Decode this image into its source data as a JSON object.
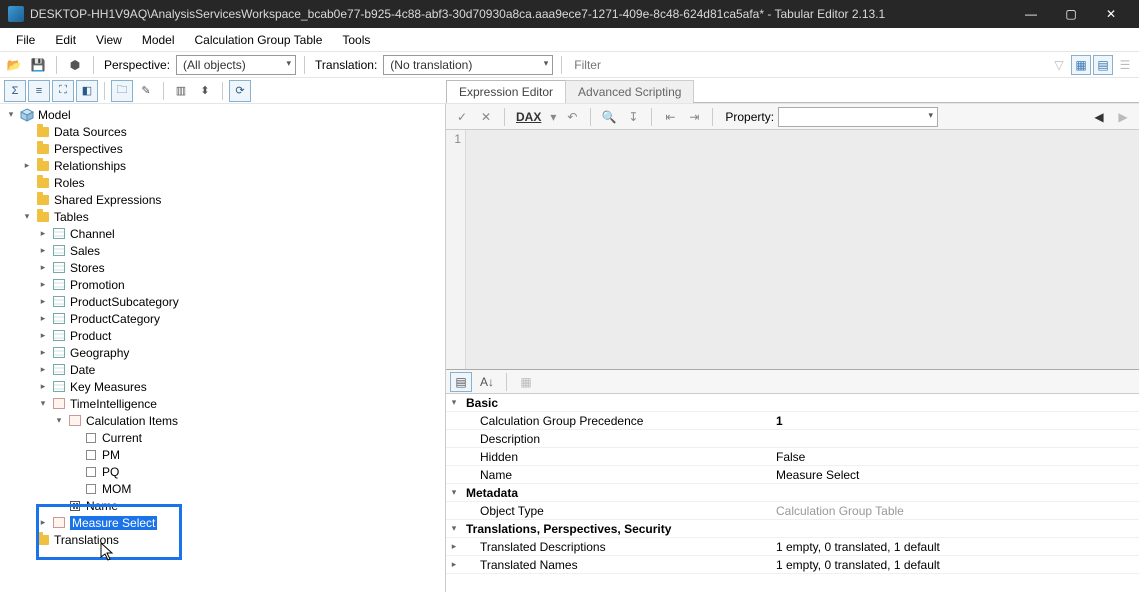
{
  "titlebar": {
    "title": "DESKTOP-HH1V9AQ\\AnalysisServicesWorkspace_bcab0e77-b925-4c88-abf3-30d70930a8ca.aaa9ece7-1271-409e-8c48-624d81ca5afa* - Tabular Editor 2.13.1"
  },
  "menubar": [
    "File",
    "Edit",
    "View",
    "Model",
    "Calculation Group Table",
    "Tools"
  ],
  "toolbar1": {
    "perspective_label": "Perspective:",
    "perspective_value": "(All objects)",
    "translation_label": "Translation:",
    "translation_value": "(No translation)",
    "filter_placeholder": "Filter"
  },
  "editor_tabs": {
    "active": "Expression Editor",
    "inactive": "Advanced Scripting"
  },
  "expr_toolbar": {
    "dax": "DAX",
    "property_label": "Property:",
    "property_value": ""
  },
  "gutter_line": "1",
  "tree": {
    "root": "Model",
    "top": [
      "Data Sources",
      "Perspectives",
      "Relationships",
      "Roles",
      "Shared Expressions"
    ],
    "tables_label": "Tables",
    "tables": [
      "Channel",
      "Sales",
      "Stores",
      "Promotion",
      "ProductSubcategory",
      "ProductCategory",
      "Product",
      "Geography",
      "Date",
      "Key Measures"
    ],
    "time_intel": "TimeIntelligence",
    "calc_items_label": "Calculation Items",
    "calc_items": [
      "Current",
      "PM",
      "PQ",
      "MOM"
    ],
    "name_col": "Name",
    "measure_select": "Measure Select",
    "translations": "Translations"
  },
  "prop_cats": {
    "basic": "Basic",
    "metadata": "Metadata",
    "trans": "Translations, Perspectives, Security"
  },
  "props": {
    "calc_prec_name": "Calculation Group Precedence",
    "calc_prec_val": "1",
    "desc_name": "Description",
    "desc_val": "",
    "hidden_name": "Hidden",
    "hidden_val": "False",
    "name_name": "Name",
    "name_val": "Measure Select",
    "objtype_name": "Object Type",
    "objtype_val": "Calculation Group Table",
    "tdesc_name": "Translated Descriptions",
    "tdesc_val": "1 empty, 0 translated, 1 default",
    "tname_name": "Translated Names",
    "tname_val": "1 empty, 0 translated, 1 default"
  }
}
